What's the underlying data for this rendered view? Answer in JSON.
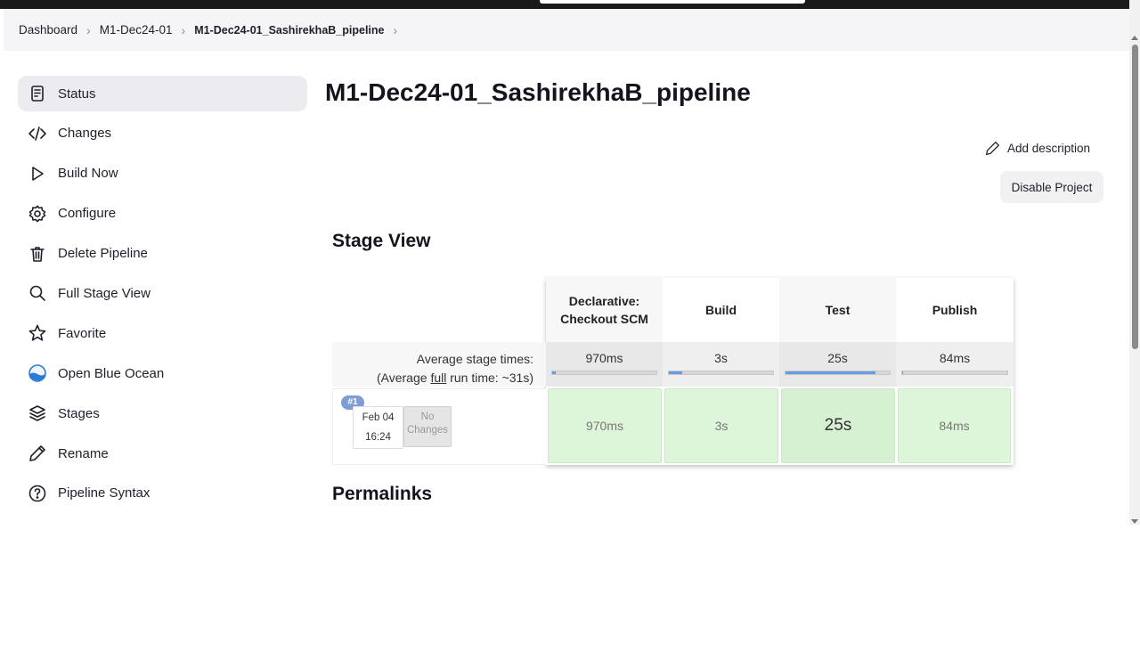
{
  "breadcrumb": {
    "items": [
      "Dashboard",
      "M1-Dec24-01",
      "M1-Dec24-01_SashirekhaB_pipeline"
    ]
  },
  "sidebar": {
    "items": [
      {
        "label": "Status",
        "icon": "status-icon"
      },
      {
        "label": "Changes",
        "icon": "code-icon"
      },
      {
        "label": "Build Now",
        "icon": "play-icon"
      },
      {
        "label": "Configure",
        "icon": "gear-icon"
      },
      {
        "label": "Delete Pipeline",
        "icon": "trash-icon"
      },
      {
        "label": "Full Stage View",
        "icon": "search-icon"
      },
      {
        "label": "Favorite",
        "icon": "star-icon"
      },
      {
        "label": "Open Blue Ocean",
        "icon": "blue-ocean-icon"
      },
      {
        "label": "Stages",
        "icon": "layers-icon"
      },
      {
        "label": "Rename",
        "icon": "pencil-icon"
      },
      {
        "label": "Pipeline Syntax",
        "icon": "help-icon"
      }
    ]
  },
  "main": {
    "title": "M1-Dec24-01_SashirekhaB_pipeline",
    "add_description": "Add description",
    "disable_project": "Disable Project",
    "stage_view_title": "Stage View",
    "permalinks_title": "Permalinks"
  },
  "stage_view": {
    "stages": [
      {
        "name_line1": "Declarative:",
        "name_line2": "Checkout SCM",
        "avg": "970ms",
        "avg_fraction": 0.03,
        "result": "970ms"
      },
      {
        "name_line1": "Build",
        "name_line2": "",
        "avg": "3s",
        "avg_fraction": 0.13,
        "result": "3s"
      },
      {
        "name_line1": "Test",
        "name_line2": "",
        "avg": "25s",
        "avg_fraction": 0.86,
        "result": "25s"
      },
      {
        "name_line1": "Publish",
        "name_line2": "",
        "avg": "84ms",
        "avg_fraction": 0.01,
        "result": "84ms"
      }
    ],
    "avg_label_line1": "Average stage times:",
    "avg_label_prefix": "(Average ",
    "avg_label_link": "full",
    "avg_label_suffix": " run time: ~31s)",
    "build": {
      "number": "#1",
      "date": "Feb 04",
      "time": "16:24",
      "changes_line1": "No",
      "changes_line2": "Changes"
    }
  },
  "colors": {
    "success_cell": "#ddf5d8",
    "progress_fill": "#6a9be0",
    "badge": "#7f9dd3"
  }
}
